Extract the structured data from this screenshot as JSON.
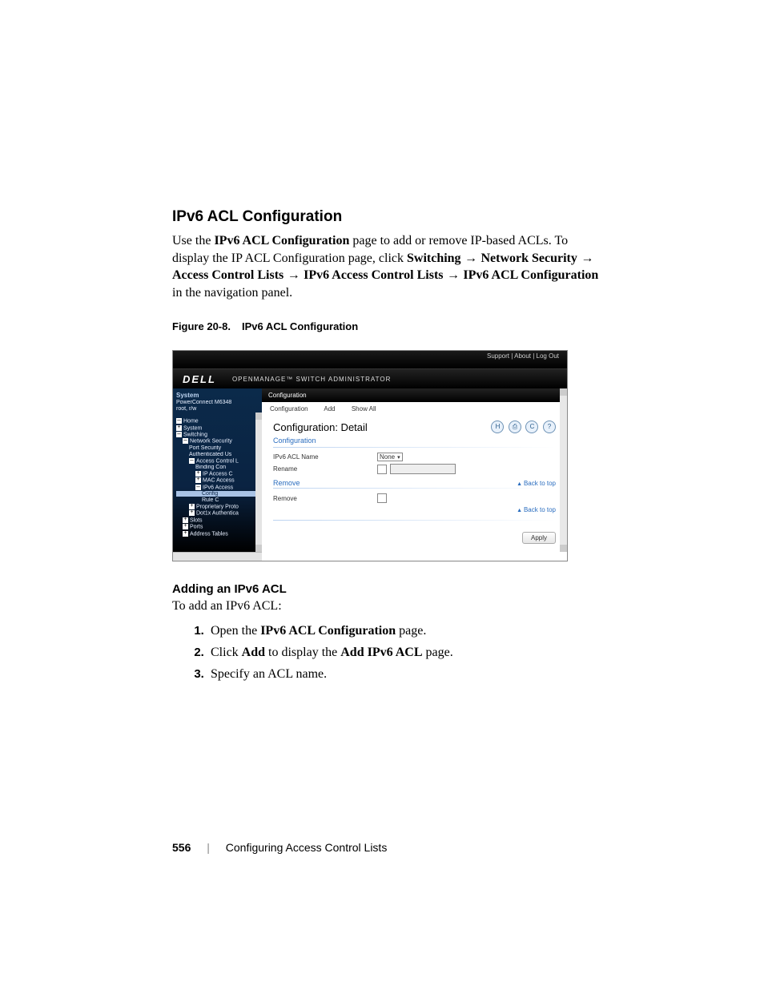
{
  "section": {
    "title": "IPv6 ACL Configuration",
    "para_parts": {
      "p1a": "Use the ",
      "p1b_bold": "IPv6 ACL Configuration",
      "p1c": " page to add or remove IP-based ACLs. To display the IP ACL Configuration page, click ",
      "p2_bold": "Switching",
      "arrow": " → ",
      "p3_bold": "Network Security",
      "p4_bold": "Access Control Lists",
      "p5_bold": "IPv6 Access Control Lists",
      "p6_bold": "IPv6 ACL Configuration",
      "p7": " in the navigation panel."
    }
  },
  "figure": {
    "num": "Figure 20-8.",
    "title": "IPv6 ACL Configuration"
  },
  "screenshot": {
    "toplinks": "Support  |  About  |  Log Out",
    "logo": "DELL",
    "subtitle_suffix": "SWITCH ADMINISTRATOR",
    "subtitle_prefix": "OPENMANAGE™  ",
    "side": {
      "system": "System",
      "model": "PowerConnect M6348",
      "user": "root, r/w",
      "items": {
        "home": "Home",
        "system": "System",
        "switching": "Switching",
        "netsec": "Network Security",
        "portsec": "Port Security",
        "authusers": "Authenticated Us",
        "acl": "Access Control L",
        "binding": "Binding Con",
        "ipacc": "IP Access C",
        "macacc": "MAC Access",
        "ipv6acc": "IPv6 Access",
        "config": "Config",
        "rulec": "Rule C",
        "proto": "Proprietary Proto",
        "dot1x": "Dot1x Authentica",
        "slots": "Slots",
        "ports": "Ports",
        "addr": "Address Tables"
      }
    },
    "crumb": "Configuration",
    "tabs": {
      "t1": "Configuration",
      "t2": "Add",
      "t3": "Show All"
    },
    "panel": {
      "title": "Configuration: Detail",
      "sub1": "Configuration",
      "row1": "IPv6 ACL Name",
      "row1val": "None",
      "row2": "Rename",
      "sec2": "Remove",
      "row3": "Remove",
      "back": "Back to top",
      "apply": "Apply",
      "icons": {
        "save": "H",
        "print": "⎙",
        "refresh": "C",
        "help": "?"
      }
    }
  },
  "subsection": {
    "title": "Adding an IPv6 ACL",
    "lead": "To add an IPv6 ACL:",
    "steps": {
      "s1a": "Open the ",
      "s1b_bold": "IPv6 ACL Configuration",
      "s1c": " page.",
      "s2a": "Click ",
      "s2b_bold": "Add",
      "s2c": " to display the ",
      "s2d_bold": "Add IPv6 ACL",
      "s2e": " page.",
      "s3": "Specify an ACL name."
    }
  },
  "footer": {
    "page": "556",
    "chapter": "Configuring Access Control Lists"
  }
}
